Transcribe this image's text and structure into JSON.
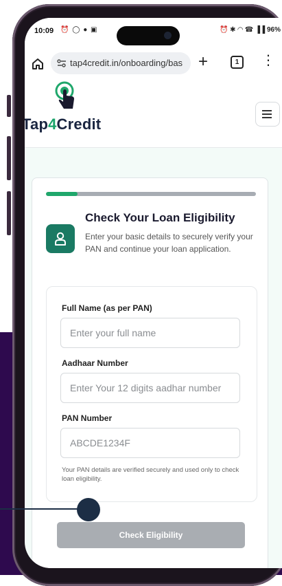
{
  "status_bar": {
    "time": "10:09",
    "left_icons": "⏰ ◯ ● ▣",
    "right_icons": "⏰ ✱ ◠ ☎ ▐▐ 96%"
  },
  "browser": {
    "url": "tap4credit.in/onboarding/bas",
    "tab_count": "1"
  },
  "site": {
    "logo_tap": "Tap",
    "logo_four": "4",
    "logo_credit": "Credit"
  },
  "form": {
    "progress": 0.15,
    "title": "Check Your Loan Eligibility",
    "subtitle": "Enter your basic details to securely verify your PAN and continue your loan application.",
    "full_name": {
      "label": "Full Name (as per PAN)",
      "placeholder": "Enter your full name",
      "value": ""
    },
    "aadhaar": {
      "label": "Aadhaar Number",
      "placeholder": "Enter Your 12 digits aadhar number",
      "value": ""
    },
    "pan": {
      "label": "PAN Number",
      "placeholder": "ABCDE1234F",
      "value": ""
    },
    "note": "Your PAN details are verified securely and used only to check loan eligibility.",
    "submit_label": "Check Eligibility"
  },
  "colors": {
    "brand_green": "#1fa76b",
    "brand_dark": "#1a2540",
    "badge": "#1a7a63",
    "purple_bg": "#2e0a4e"
  }
}
